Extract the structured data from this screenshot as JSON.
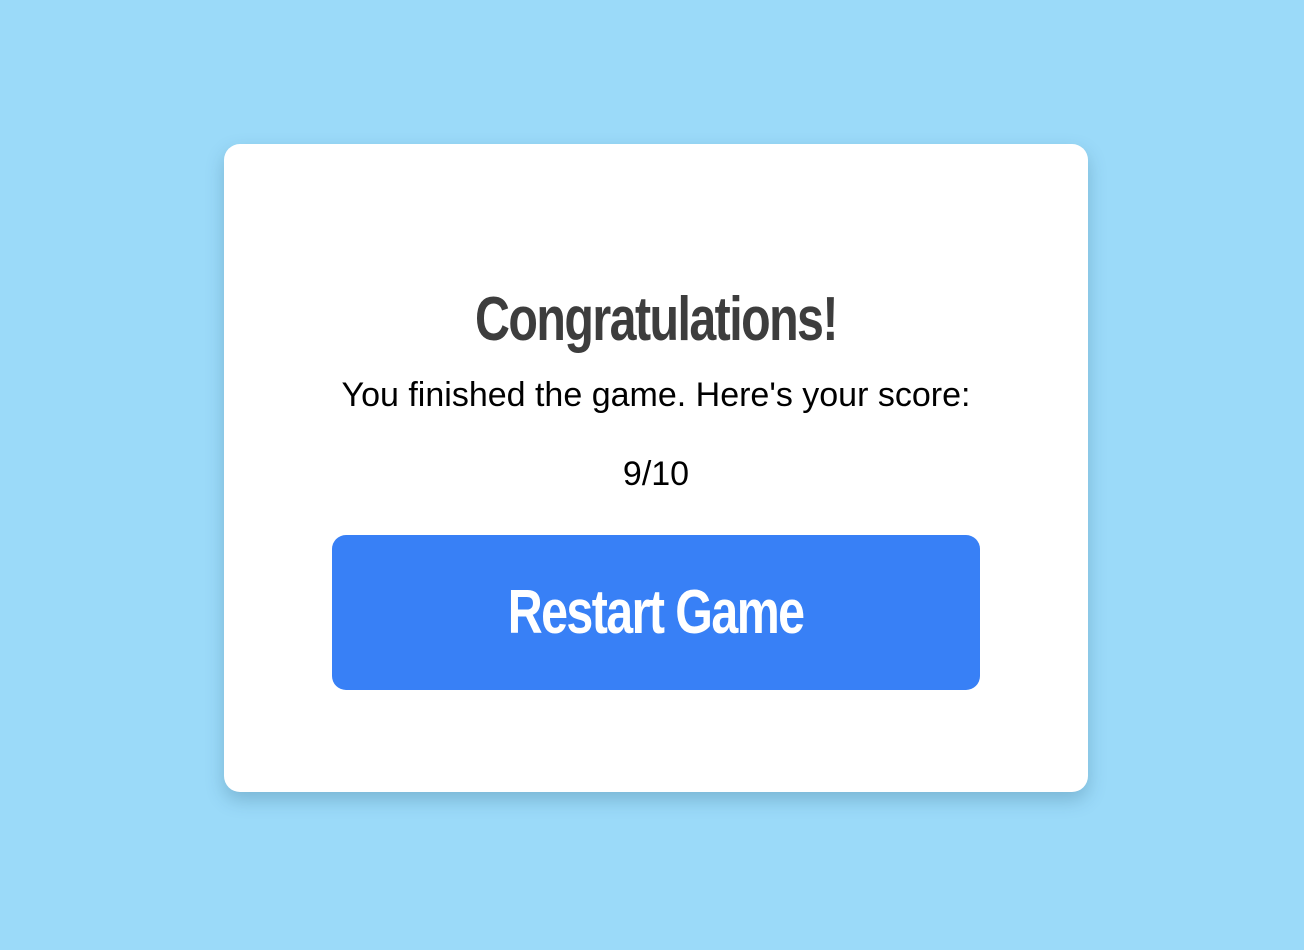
{
  "colors": {
    "page_background": "#9bdaf9",
    "card_background": "#ffffff",
    "title_text": "#3d3d3d",
    "button_background": "#3880f6",
    "button_text": "#ffffff"
  },
  "results": {
    "title": "Congratulations!",
    "message": "You finished the game. Here's your score:",
    "score": "9/10",
    "score_value": 9,
    "score_max": 10
  },
  "actions": {
    "restart_label": "Restart Game"
  }
}
